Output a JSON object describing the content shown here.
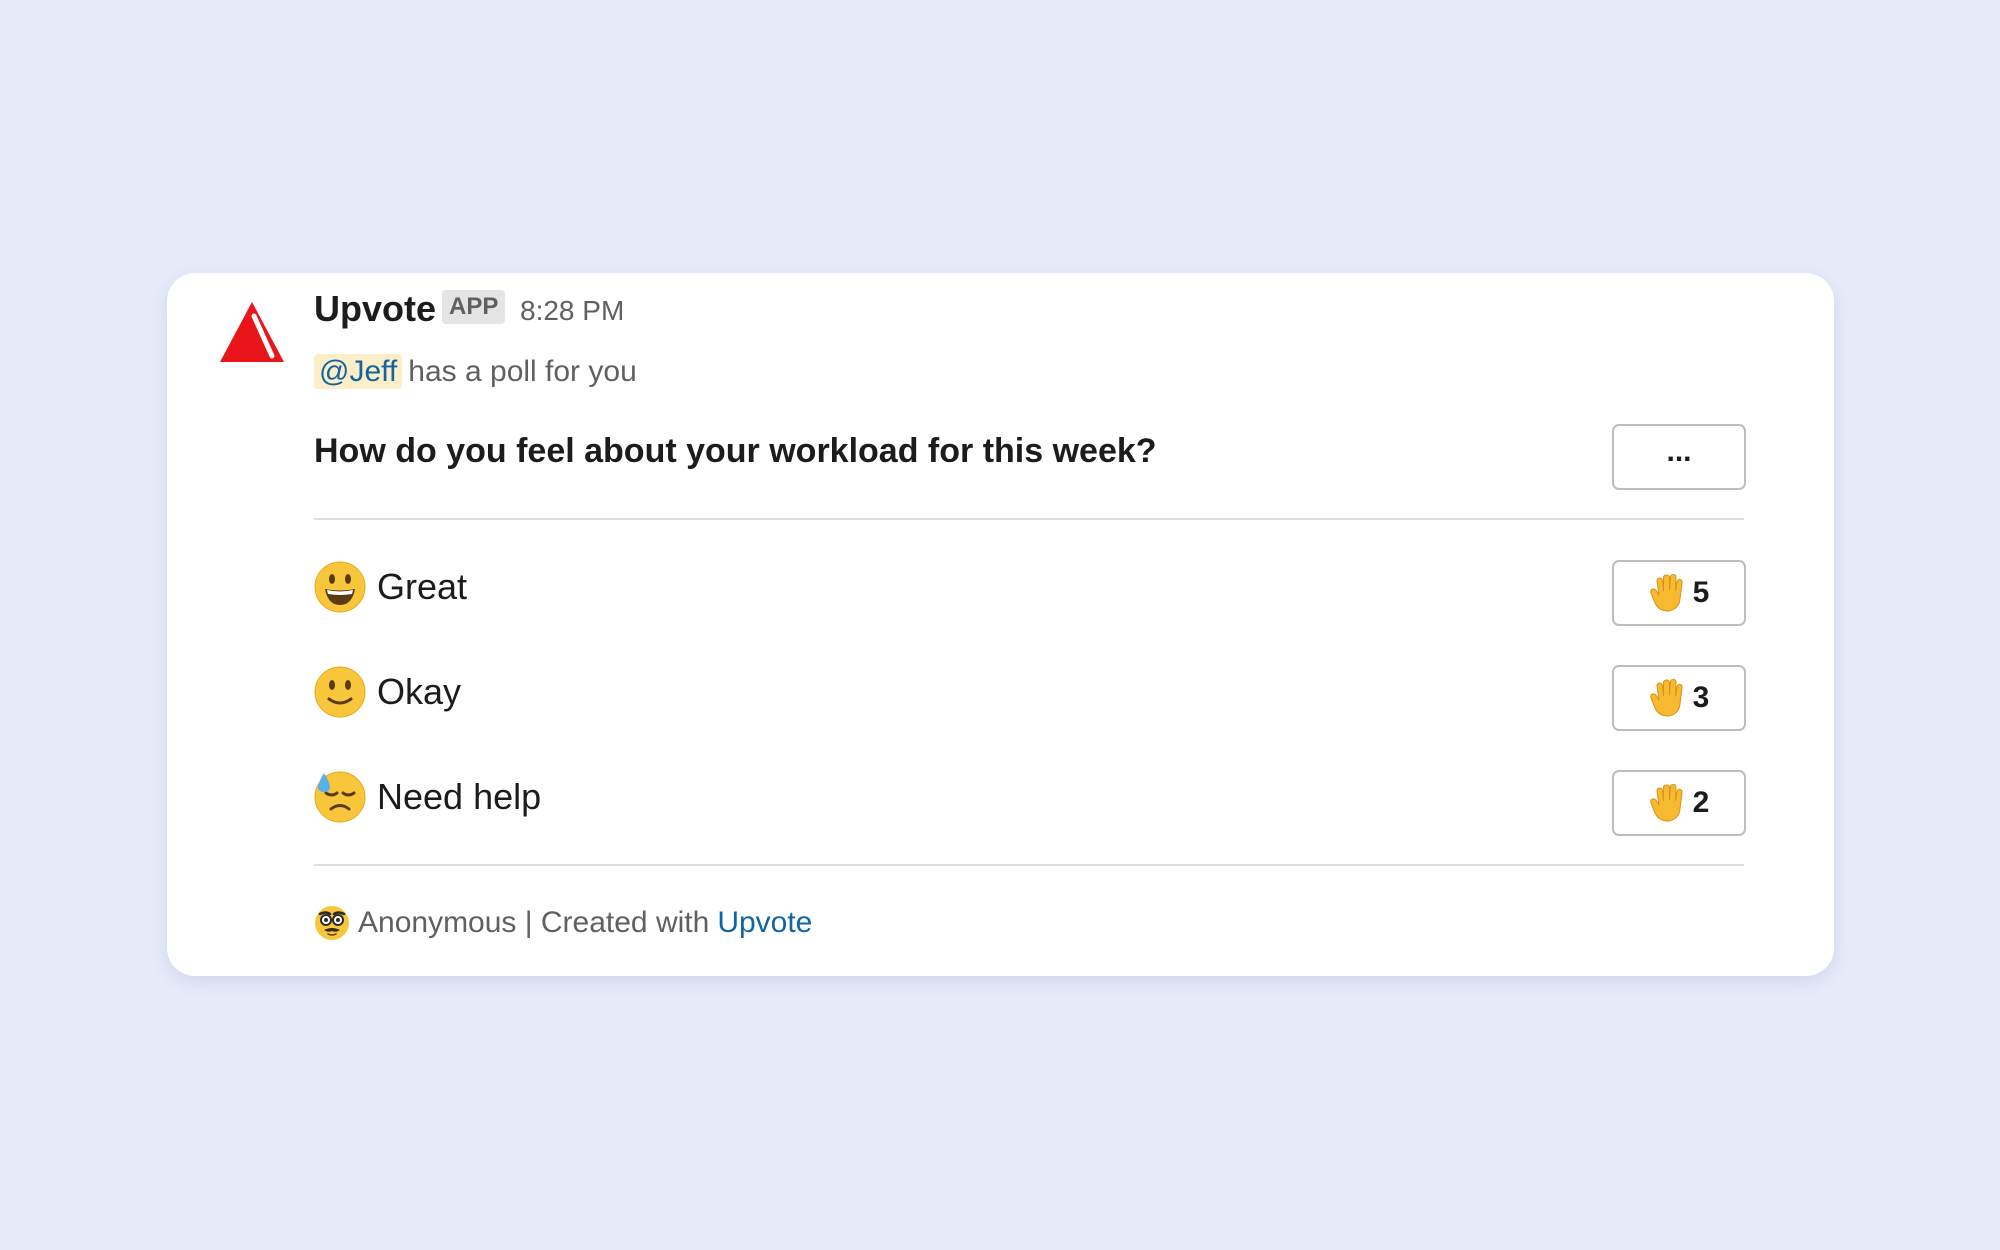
{
  "message": {
    "app_name": "Upvote",
    "app_badge": "APP",
    "timestamp": "8:28 PM",
    "mention": "@Jeff",
    "intro_text": "has a poll for you",
    "avatar_icon": "upvote-logo-icon"
  },
  "poll": {
    "question": "How do you feel about your workload for this week?",
    "more_button_label": "...",
    "options": [
      {
        "emoji": "grinning-face-icon",
        "label": "Great",
        "vote_icon": "raised-hand-icon",
        "votes": "5"
      },
      {
        "emoji": "slightly-smiling-face-icon",
        "label": "Okay",
        "vote_icon": "raised-hand-icon",
        "votes": "3"
      },
      {
        "emoji": "downcast-face-with-sweat-icon",
        "label": "Need help",
        "vote_icon": "raised-hand-icon",
        "votes": "2"
      }
    ]
  },
  "footer": {
    "emoji": "disguised-face-icon",
    "text": "Anonymous | Created with",
    "link_text": "Upvote"
  },
  "colors": {
    "background": "#e5ebf9",
    "brand_red": "#e8151b",
    "link_blue": "#1264a3",
    "mention_bg": "#fcefc7"
  }
}
